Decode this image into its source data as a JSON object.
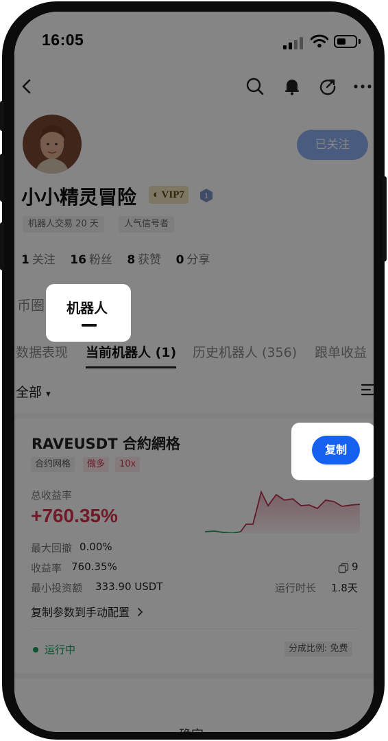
{
  "status_bar": {
    "time": "16:05"
  },
  "profile": {
    "name": "小小精灵冒险",
    "vip_label": "VIP7",
    "level": "1",
    "follow_button": "已关注",
    "tags": [
      "机器人交易 20 天",
      "人气信号者"
    ],
    "stats": [
      {
        "value": "1",
        "label": "关注"
      },
      {
        "value": "16",
        "label": "粉丝"
      },
      {
        "value": "8",
        "label": "获赞"
      },
      {
        "value": "0",
        "label": "分享"
      }
    ]
  },
  "main_tabs": [
    "币圈",
    "机器人"
  ],
  "sub_tabs": [
    "数据表现",
    "当前机器人 (1)",
    "历史机器人 (356)",
    "跟单收益"
  ],
  "filter": {
    "label": "全部",
    "arrow": "▾"
  },
  "bot_card": {
    "title": "RAVEUSDT 合約網格",
    "chips": [
      "合约网格",
      "做多",
      "10x"
    ],
    "copy_button": "复制",
    "pnl_label": "总收益率",
    "pnl_value": "+760.35%",
    "max_drawdown_label": "最大回撤",
    "max_drawdown_value": "0.00%",
    "return_label": "收益率",
    "return_value": "760.35%",
    "copies_count": "9",
    "min_invest_label": "最小投资额",
    "min_invest_value": "333.90 USDT",
    "runtime_label": "运行时长",
    "runtime_value": "1.8天",
    "copy_params_link": "复制参数到手动配置",
    "status": "运行中",
    "share_ratio": "分成比例: 免费",
    "sparkline_up_color": "#c0314f",
    "sparkline_down_color": "#1f9a58"
  },
  "bottom_hint": "确定",
  "icons": [
    "back-icon",
    "search-icon",
    "bell-icon",
    "share-icon",
    "more-icon",
    "filter-icon",
    "copy-count-icon",
    "chevron-right-icon"
  ]
}
